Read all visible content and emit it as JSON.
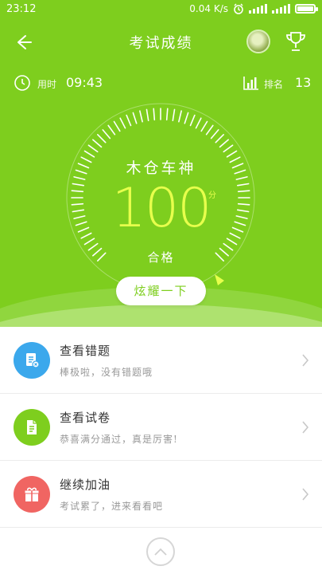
{
  "status_bar": {
    "time": "23:12",
    "speed": "0.04 K/s",
    "network": "4G"
  },
  "header": {
    "title": "考试成绩"
  },
  "stats": {
    "time_label": "用时",
    "time_value": "09:43",
    "rank_label": "排名",
    "rank_value": "13"
  },
  "result": {
    "rank_title": "木仓车神",
    "score": "100",
    "unit": "分",
    "pass_label": "合格",
    "share_button": "炫耀一下"
  },
  "list": [
    {
      "title": "查看错题",
      "subtitle": "棒极啦，没有错题哦",
      "icon": "wrong-questions-icon",
      "color": "#3ba8ec"
    },
    {
      "title": "查看试卷",
      "subtitle": "恭喜满分通过，真是厉害!",
      "icon": "exam-paper-icon",
      "color": "#7ece1e"
    },
    {
      "title": "继续加油",
      "subtitle": "考试累了，进来看看吧",
      "icon": "gift-icon",
      "color": "#f06562"
    }
  ],
  "colors": {
    "primary": "#7ece1e",
    "score": "#e7ff4c"
  }
}
